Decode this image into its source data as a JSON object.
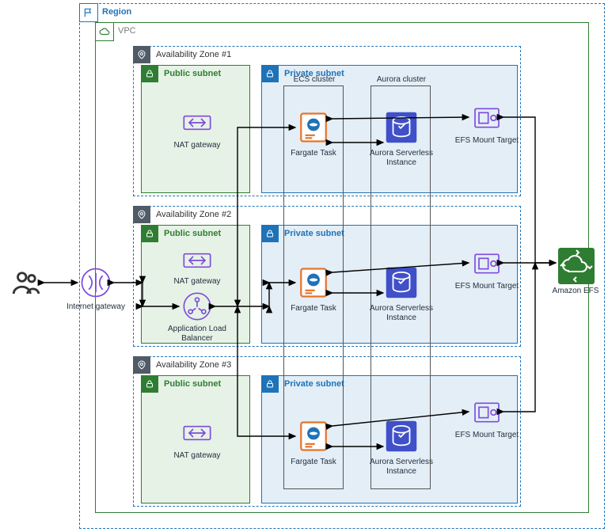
{
  "region": {
    "label": "Region"
  },
  "vpc": {
    "label": "VPC"
  },
  "azs": [
    {
      "label": "Availability Zone #1"
    },
    {
      "label": "Availability Zone #2"
    },
    {
      "label": "Availability Zone #3"
    }
  ],
  "public_subnet_label": "Public subnet",
  "private_subnet_label": "Private subnet",
  "clusters": {
    "ecs": "ECS cluster",
    "aurora": "Aurora cluster"
  },
  "icons": {
    "users": "Users",
    "igw": "Internet gateway",
    "nat": "NAT gateway",
    "alb": "Application Load Balancer",
    "fargate": "Fargate Task",
    "aurora": "Aurora Serverless Instance",
    "efsmt": "EFS Mount Target",
    "efs": "Amazon EFS"
  },
  "colors": {
    "region": "#1E73B8",
    "vpc": "#2F7D32",
    "az_border": "#1E73B8",
    "az_badge": "#4F5B66",
    "public_fill": "#E6F2E6",
    "public_border": "#2F7D32",
    "private_fill": "#E3EEF7",
    "private_border": "#1E73B8",
    "purple": "#7D4CDB",
    "orange": "#E6732A",
    "aurora": "#4050C8",
    "efs": "#2F7D32"
  }
}
